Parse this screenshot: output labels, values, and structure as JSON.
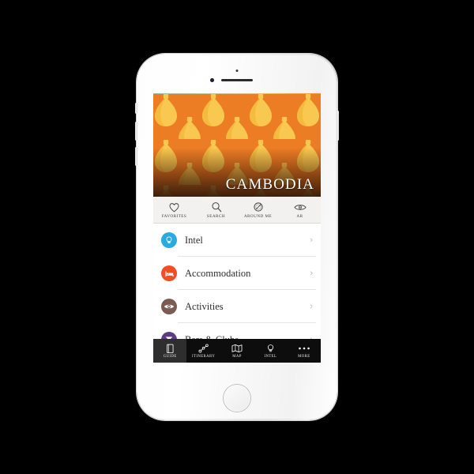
{
  "app": {
    "hero": {
      "title": "CAMBODIA",
      "background_color": "#ED7D25",
      "motif_color": "#F9C850"
    },
    "quick_actions": [
      {
        "label": "FAVORITES",
        "icon": "heart-icon"
      },
      {
        "label": "SEARCH",
        "icon": "search-icon"
      },
      {
        "label": "AROUND ME",
        "icon": "compass-icon"
      },
      {
        "label": "AR",
        "icon": "eye-icon"
      }
    ],
    "list": [
      {
        "label": "Intel",
        "icon": "lightbulb-icon",
        "color": "#29ABE2",
        "chevron": "›"
      },
      {
        "label": "Accommodation",
        "icon": "bed-icon",
        "color": "#F04E23",
        "chevron": "›"
      },
      {
        "label": "Activities",
        "icon": "eye-icon",
        "color": "#7A5C52",
        "chevron": "›"
      },
      {
        "label": "Bars & Clubs",
        "icon": "cocktail-icon",
        "color": "#5B3C7E",
        "chevron": "›"
      }
    ],
    "tabs": [
      {
        "label": "GUIDE",
        "icon": "book-icon",
        "active": true
      },
      {
        "label": "ITINERARY",
        "icon": "route-icon",
        "active": false
      },
      {
        "label": "MAP",
        "icon": "map-icon",
        "active": false
      },
      {
        "label": "INTEL",
        "icon": "lightbulb-icon",
        "active": false
      },
      {
        "label": "MORE",
        "icon": "ellipsis-icon",
        "active": false
      }
    ]
  }
}
